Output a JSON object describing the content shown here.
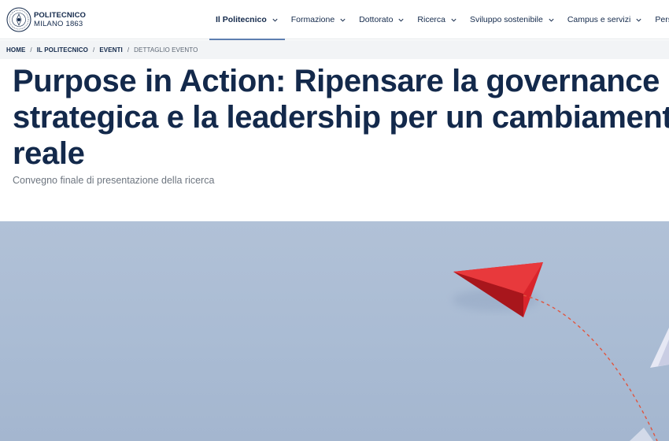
{
  "header": {
    "logo": {
      "line1": "POLITECNICO",
      "line2": "MILANO 1863",
      "icon": "politecnico-seal-icon"
    },
    "nav": [
      {
        "label": "Il Politecnico",
        "active": true
      },
      {
        "label": "Formazione",
        "active": false
      },
      {
        "label": "Dottorato",
        "active": false
      },
      {
        "label": "Ricerca",
        "active": false
      },
      {
        "label": "Sviluppo sostenibile",
        "active": false
      },
      {
        "label": "Campus e servizi",
        "active": false
      },
      {
        "label": "Persone",
        "active": false
      }
    ]
  },
  "breadcrumb": [
    {
      "label": "HOME"
    },
    {
      "label": "IL POLITECNICO"
    },
    {
      "label": "EVENTI"
    },
    {
      "label": "DETTAGLIO EVENTO"
    }
  ],
  "page": {
    "title": "Purpose in Action: Ripensare la governance strategica e la leadership per un cambiamento reale",
    "subtitle": "Convegno finale di presentazione della ricerca"
  },
  "colors": {
    "brand_navy": "#13294b",
    "nav_accent": "#5d7fb0",
    "hero_sky": "#b1c1d7",
    "plane_red": "#d9242b"
  }
}
